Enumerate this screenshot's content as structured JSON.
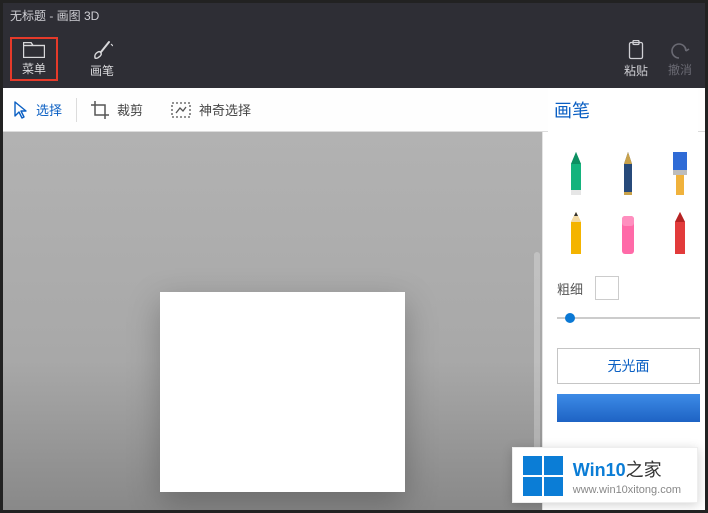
{
  "title": "无标题 - 画图 3D",
  "ribbon": {
    "menu": "菜单",
    "brush": "画笔",
    "paste": "粘贴",
    "undo": "撤消"
  },
  "subbar": {
    "select": "选择",
    "crop": "裁剪",
    "magic": "神奇选择"
  },
  "panel": {
    "title": "画笔",
    "thickness": "粗细",
    "finish": "无光面"
  },
  "watermark": {
    "brand_prefix": "Win10",
    "brand_suffix": "之家",
    "url": "www.win10xitong.com"
  }
}
